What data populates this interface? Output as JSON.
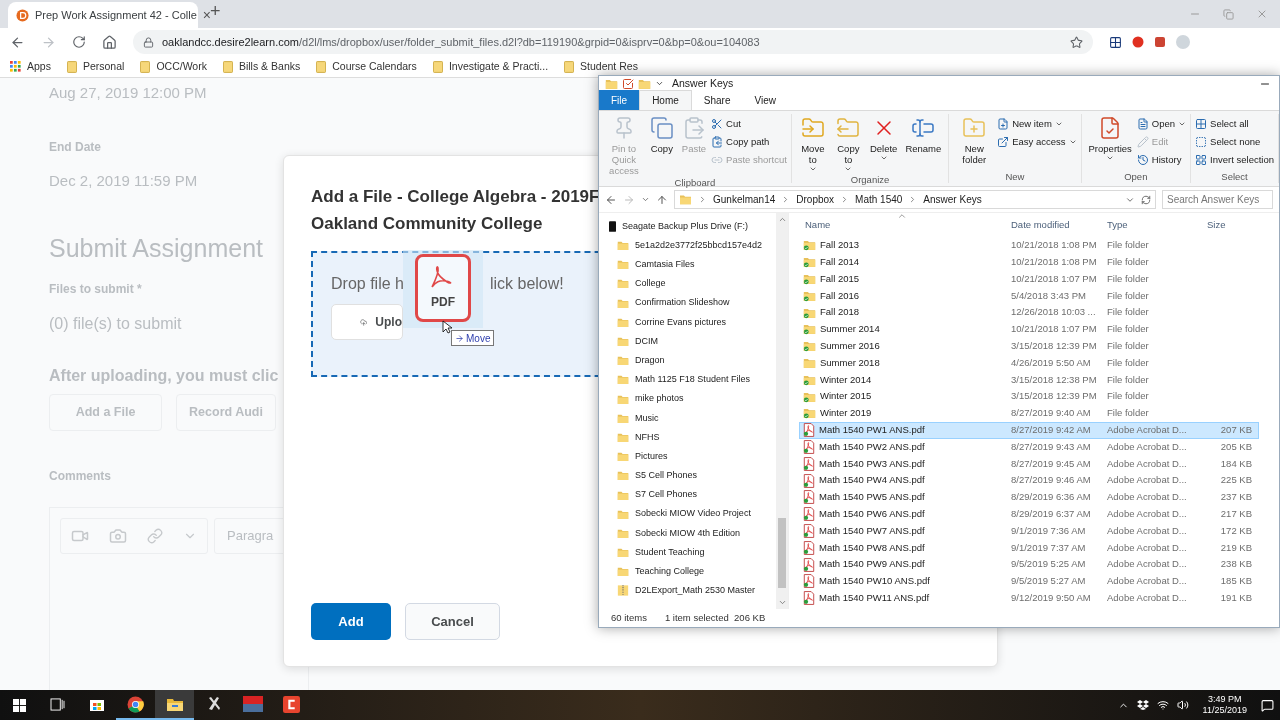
{
  "browser": {
    "tab": {
      "title": "Prep Work Assignment 42 - Colle",
      "close": "×"
    },
    "new_tab": "+",
    "url_host": "oaklandcc.desire2learn.com",
    "url_path": "/d2l/lms/dropbox/user/folder_submit_files.d2l?db=119190&grpid=0&isprv=0&bp=0&ou=104083",
    "bookmarks": [
      {
        "kind": "apps",
        "label": "Apps"
      },
      {
        "kind": "folder",
        "label": "Personal"
      },
      {
        "kind": "folder",
        "label": "OCC/Work"
      },
      {
        "kind": "folder",
        "label": "Bills & Banks"
      },
      {
        "kind": "folder",
        "label": "Course Calendars"
      },
      {
        "kind": "folder",
        "label": "Investigate & Practi..."
      },
      {
        "kind": "folder",
        "label": "Student Res"
      }
    ]
  },
  "page": {
    "start_date": "Aug 27, 2019 12:00 PM",
    "end_date_label": "End Date",
    "end_date": "Dec 2, 2019 11:59 PM",
    "heading": "Submit Assignment",
    "files_label": "Files to submit *",
    "files_count": "(0) file(s) to submit",
    "instruction": "After uploading, you must clic",
    "buttons": [
      "Add a File",
      "Record Audi"
    ],
    "comments_label": "Comments",
    "editor_format": "Paragra"
  },
  "dialog": {
    "title_lines": [
      "Add a File - College Algebra - 2019F",
      "Oakland Community College"
    ],
    "drop_text_parts": [
      "Drop file h",
      "lick below!"
    ],
    "upload_button": "Uplo",
    "drag": {
      "file_label": "PDF",
      "effect": "Move"
    },
    "buttons": [
      {
        "label": "Add",
        "primary": true
      },
      {
        "label": "Cancel",
        "primary": false
      }
    ]
  },
  "explorer": {
    "title": "Answer Keys",
    "tabs": [
      {
        "label": "File",
        "kind": "file",
        "selected": false
      },
      {
        "label": "Home",
        "kind": "tab",
        "selected": true
      },
      {
        "label": "Share",
        "kind": "tab",
        "selected": false
      },
      {
        "label": "View",
        "kind": "tab",
        "selected": false
      }
    ],
    "groups": [
      {
        "label": "Clipboard",
        "items": [
          {
            "kind": "large",
            "label": "Pin to Quick access",
            "disabled": true,
            "menu": false
          },
          {
            "kind": "large",
            "label": "Copy",
            "disabled": false,
            "menu": false
          },
          {
            "kind": "large",
            "label": "Paste",
            "disabled": true,
            "menu": false
          },
          {
            "kind": "small",
            "label": "Cut",
            "disabled": false,
            "menu": false
          },
          {
            "kind": "small",
            "label": "Copy path",
            "disabled": false,
            "menu": false
          },
          {
            "kind": "small",
            "label": "Paste shortcut",
            "disabled": true,
            "menu": false
          }
        ]
      },
      {
        "label": "Organize",
        "items": [
          {
            "kind": "large",
            "label": "Move to",
            "disabled": false,
            "menu": true
          },
          {
            "kind": "large",
            "label": "Copy to",
            "disabled": false,
            "menu": true
          },
          {
            "kind": "large",
            "label": "Delete",
            "disabled": false,
            "menu": true
          },
          {
            "kind": "large",
            "label": "Rename",
            "disabled": false,
            "menu": false
          }
        ]
      },
      {
        "label": "New",
        "items": [
          {
            "kind": "large",
            "label": "New folder",
            "disabled": false,
            "menu": false
          },
          {
            "kind": "small",
            "label": "New item",
            "disabled": false,
            "menu": true
          },
          {
            "kind": "small",
            "label": "Easy access",
            "disabled": false,
            "menu": true
          }
        ]
      },
      {
        "label": "Open",
        "items": [
          {
            "kind": "large",
            "label": "Properties",
            "disabled": false,
            "menu": true
          },
          {
            "kind": "small",
            "label": "Open",
            "disabled": false,
            "menu": true
          },
          {
            "kind": "small",
            "label": "Edit",
            "disabled": true,
            "menu": false
          },
          {
            "kind": "small",
            "label": "History",
            "disabled": false,
            "menu": false
          }
        ]
      },
      {
        "label": "Select",
        "items": [
          {
            "kind": "small",
            "label": "Select all",
            "disabled": false,
            "menu": false
          },
          {
            "kind": "small",
            "label": "Select none",
            "disabled": false,
            "menu": false
          },
          {
            "kind": "small",
            "label": "Invert selection",
            "disabled": false,
            "menu": false
          }
        ]
      }
    ],
    "path": [
      "Gunkelman14",
      "Dropbox",
      "Math 1540",
      "Answer Keys"
    ],
    "search_placeholder": "Search Answer Keys",
    "nav": {
      "kind": "drive",
      "label": "Seagate Backup Plus Drive (F:)",
      "children": [
        {
          "kind": "folder",
          "label": "5e1a2d2e3772f25bbcd157e4d2"
        },
        {
          "kind": "folder",
          "label": "Camtasia Files"
        },
        {
          "kind": "folder",
          "label": "College"
        },
        {
          "kind": "folder",
          "label": "Confirmation Slideshow"
        },
        {
          "kind": "folder",
          "label": "Corrine Evans pictures"
        },
        {
          "kind": "folder",
          "label": "DCIM"
        },
        {
          "kind": "folder",
          "label": "Dragon"
        },
        {
          "kind": "folder",
          "label": "Math 1125 F18 Student Files"
        },
        {
          "kind": "folder",
          "label": "mike photos"
        },
        {
          "kind": "folder",
          "label": "Music"
        },
        {
          "kind": "folder",
          "label": "NFHS"
        },
        {
          "kind": "folder",
          "label": "Pictures"
        },
        {
          "kind": "folder",
          "label": "S5 Cell Phones"
        },
        {
          "kind": "folder",
          "label": "S7 Cell Phones"
        },
        {
          "kind": "folder",
          "label": "Sobecki  MIOW Video Project"
        },
        {
          "kind": "folder",
          "label": "Sobecki MIOW 4th Edition"
        },
        {
          "kind": "folder",
          "label": "Student Teaching"
        },
        {
          "kind": "folder",
          "label": "Teaching College"
        },
        {
          "kind": "zip",
          "label": "D2LExport_Math 2530 Master"
        }
      ]
    },
    "columns": [
      "Name",
      "Date modified",
      "Type",
      "Size"
    ],
    "rows": [
      {
        "kind": "folder",
        "name": "Fall 2013",
        "synced": true,
        "date": "10/21/2018 1:08 PM",
        "type": "File folder",
        "selected": false
      },
      {
        "kind": "folder",
        "name": "Fall 2014",
        "synced": true,
        "date": "10/21/2018 1:08 PM",
        "type": "File folder",
        "selected": false
      },
      {
        "kind": "folder",
        "name": "Fall 2015",
        "synced": true,
        "date": "10/21/2018 1:07 PM",
        "type": "File folder",
        "selected": false
      },
      {
        "kind": "folder",
        "name": "Fall 2016",
        "synced": true,
        "date": "5/4/2018 3:43 PM",
        "type": "File folder",
        "selected": false
      },
      {
        "kind": "folder",
        "name": "Fall 2018",
        "synced": true,
        "date": "12/26/2018 10:03 ...",
        "type": "File folder",
        "selected": false
      },
      {
        "kind": "folder",
        "name": "Summer 2014",
        "synced": true,
        "date": "10/21/2018 1:07 PM",
        "type": "File folder",
        "selected": false
      },
      {
        "kind": "folder",
        "name": "Summer 2016",
        "synced": true,
        "date": "3/15/2018 12:39 PM",
        "type": "File folder",
        "selected": false
      },
      {
        "kind": "folder",
        "name": "Summer 2018",
        "synced": false,
        "date": "4/26/2019 5:50 AM",
        "type": "File folder",
        "selected": false
      },
      {
        "kind": "folder",
        "name": "Winter 2014",
        "synced": true,
        "date": "3/15/2018 12:38 PM",
        "type": "File folder",
        "selected": false
      },
      {
        "kind": "folder",
        "name": "Winter 2015",
        "synced": true,
        "date": "3/15/2018 12:39 PM",
        "type": "File folder",
        "selected": false
      },
      {
        "kind": "folder",
        "name": "Winter 2019",
        "synced": true,
        "date": "8/27/2019 9:40 AM",
        "type": "File folder",
        "selected": false
      },
      {
        "kind": "pdf",
        "name": "Math 1540 PW1 ANS.pdf",
        "synced": true,
        "date": "8/27/2019 9:42 AM",
        "type": "Adobe Acrobat D...",
        "size": "207 KB",
        "selected": true
      },
      {
        "kind": "pdf",
        "name": "Math 1540 PW2 ANS.pdf",
        "synced": true,
        "date": "8/27/2019 9:43 AM",
        "type": "Adobe Acrobat D...",
        "size": "205 KB",
        "selected": false
      },
      {
        "kind": "pdf",
        "name": "Math 1540 PW3 ANS.pdf",
        "synced": true,
        "date": "8/27/2019 9:45 AM",
        "type": "Adobe Acrobat D...",
        "size": "184 KB",
        "selected": false
      },
      {
        "kind": "pdf",
        "name": "Math 1540 PW4 ANS.pdf",
        "synced": true,
        "date": "8/27/2019 9:46 AM",
        "type": "Adobe Acrobat D...",
        "size": "225 KB",
        "selected": false
      },
      {
        "kind": "pdf",
        "name": "Math 1540 PW5 ANS.pdf",
        "synced": true,
        "date": "8/29/2019 6:36 AM",
        "type": "Adobe Acrobat D...",
        "size": "237 KB",
        "selected": false
      },
      {
        "kind": "pdf",
        "name": "Math 1540 PW6 ANS.pdf",
        "synced": true,
        "date": "8/29/2019 6:37 AM",
        "type": "Adobe Acrobat D...",
        "size": "217 KB",
        "selected": false
      },
      {
        "kind": "pdf",
        "name": "Math 1540 PW7 ANS.pdf",
        "synced": true,
        "date": "9/1/2019 7:36 AM",
        "type": "Adobe Acrobat D...",
        "size": "172 KB",
        "selected": false
      },
      {
        "kind": "pdf",
        "name": "Math 1540 PW8 ANS.pdf",
        "synced": true,
        "date": "9/1/2019 7:37 AM",
        "type": "Adobe Acrobat D...",
        "size": "219 KB",
        "selected": false
      },
      {
        "kind": "pdf",
        "name": "Math 1540 PW9 ANS.pdf",
        "synced": true,
        "date": "9/5/2019 5:25 AM",
        "type": "Adobe Acrobat D...",
        "size": "238 KB",
        "selected": false
      },
      {
        "kind": "pdf",
        "name": "Math 1540 PW10 ANS.pdf",
        "synced": true,
        "date": "9/5/2019 5:27 AM",
        "type": "Adobe Acrobat D...",
        "size": "185 KB",
        "selected": false
      },
      {
        "kind": "pdf",
        "name": "Math 1540 PW11 ANS.pdf",
        "synced": true,
        "date": "9/12/2019 9:50 AM",
        "type": "Adobe Acrobat D...",
        "size": "191 KB",
        "selected": false
      }
    ],
    "status": {
      "count": "60 items",
      "selection": "1 item selected  206 KB"
    }
  },
  "taskbar": {
    "apps": [
      {
        "kind": "taskview",
        "running": false,
        "selected": false
      },
      {
        "kind": "store",
        "running": false,
        "selected": false
      },
      {
        "kind": "chrome",
        "running": true,
        "selected": false
      },
      {
        "kind": "explorer",
        "running": true,
        "selected": true
      },
      {
        "kind": "tool",
        "running": false,
        "selected": false
      },
      {
        "kind": "mixer",
        "running": false,
        "selected": false
      },
      {
        "kind": "recorder",
        "running": false,
        "selected": false
      }
    ],
    "time": "3:49 PM",
    "date": "11/25/2019"
  }
}
